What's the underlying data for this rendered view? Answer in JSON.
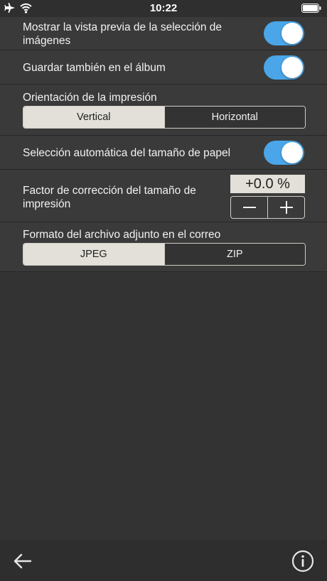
{
  "status_bar": {
    "time": "10:22"
  },
  "settings": {
    "show_preview": {
      "label": "Mostrar la vista previa de la selección de imágenes",
      "enabled": true
    },
    "save_to_album": {
      "label": "Guardar también en el álbum",
      "enabled": true
    },
    "orientation": {
      "label": "Orientación de la impresión",
      "options": [
        "Vertical",
        "Horizontal"
      ],
      "selected": "Vertical"
    },
    "auto_paper_size": {
      "label": "Selección automática del tamaño de papel",
      "enabled": true
    },
    "size_correction": {
      "label": "Factor de corrección del tamaño de impresión",
      "value": "+0.0 %"
    },
    "mail_attachment": {
      "label": "Formato del archivo adjunto en el correo",
      "options": [
        "JPEG",
        "ZIP"
      ],
      "selected": "JPEG"
    }
  },
  "colors": {
    "accent": "#4aa6e8",
    "background": "#333333",
    "row": "#3a3a3a",
    "selected_segment": "#e2e0d8"
  }
}
